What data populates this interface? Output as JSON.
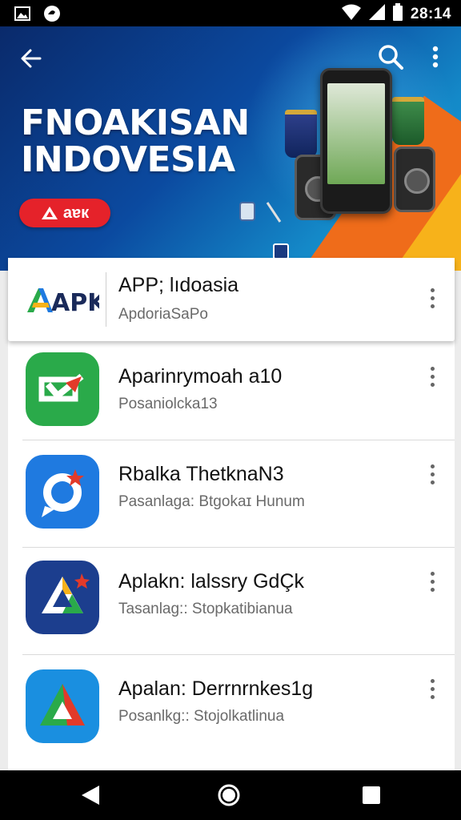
{
  "status_bar": {
    "time": "28:14",
    "icons": [
      "image-icon",
      "notification-icon",
      "wifi-icon",
      "signal-icon",
      "battery-icon"
    ]
  },
  "hero": {
    "headline_line1": "FNOAKISAN",
    "headline_line2": "INDOVESIA",
    "badge_label": "aɐк",
    "colors": {
      "bg_dark": "#0a2a6b",
      "bg_light": "#1c9fd6",
      "badge": "#e5222a",
      "stripe_orange": "#ef6c1a",
      "stripe_yellow": "#f7b21a"
    }
  },
  "featured": {
    "logo_text": "APK",
    "title": "APP; lıdoasia",
    "subtitle": "ApdoriaSaPo"
  },
  "apps": [
    {
      "title": "Aparinrymoah a10",
      "subtitle": "Posaniolcka13",
      "icon": "check-arrow-app-icon",
      "icon_color": "#2aaa4a"
    },
    {
      "title": "Rbalka ThetknaN3",
      "subtitle": "Pasanlaga: Btgokaɪ Hunum",
      "icon": "chat-bubble-app-icon",
      "icon_color": "#1f7ae0"
    },
    {
      "title": "Aplakn: lalssry GdÇk",
      "subtitle": "Tasanlag:: Stopkatibianua",
      "icon": "triangle-drive-app-icon",
      "icon_color": "#1c3e8e"
    },
    {
      "title": "Apalan: Derrnrnkes1g",
      "subtitle": "Posanlkg:: Stojolkatlinua",
      "icon": "triangle-app-icon",
      "icon_color": "#1a8fe0"
    }
  ]
}
